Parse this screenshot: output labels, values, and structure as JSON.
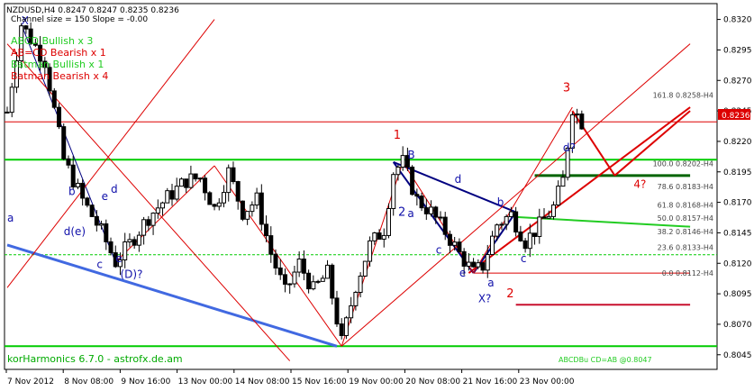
{
  "chart_window": {
    "title_line": "NZDUSD,H4  0.8247 0.8247 0.8235 0.8236",
    "info_line": "Channel size = 150  Slope = -0.00",
    "pattern_summary": [
      {
        "text": "ABCD Bullish x 3",
        "color": "#22cc22"
      },
      {
        "text": "AB=CD Bearish x 1",
        "color": "#dd0000"
      },
      {
        "text": "Batman Bullish x 1",
        "color": "#22cc22"
      },
      {
        "text": "Batman Bearish x 4",
        "color": "#dd0000"
      }
    ],
    "footer_left": "korHarmonics 6.7.0 - astrofx.de.am",
    "footer_right": "ABCDBu CD=AB   @0.8047",
    "current_price": "0.8236",
    "colors": {
      "bull": "#00cc00",
      "bear": "#dd0000",
      "pattern_blue": "#000080",
      "label_blue": "#1010aa",
      "price_box": "#dd0000",
      "trend_blue": "#4169e1",
      "darkgreen": "#006400",
      "crimson": "#c8102e"
    }
  },
  "chart_data": {
    "type": "candlestick",
    "symbol": "NZDUSD",
    "timeframe": "H4",
    "y_range": [
      0.8033,
      0.8333
    ],
    "x_ticks": [
      "7 Nov 2012",
      "8 Nov 08:00",
      "9 Nov 16:00",
      "13 Nov 00:00",
      "14 Nov 08:00",
      "15 Nov 16:00",
      "19 Nov 00:00",
      "20 Nov 08:00",
      "21 Nov 16:00",
      "23 Nov 00:00"
    ],
    "y_ticks": [
      "0.8320",
      "0.8295",
      "0.8270",
      "0.8245",
      "0.8220",
      "0.8195",
      "0.8170",
      "0.8145",
      "0.8120",
      "0.8095",
      "0.8070",
      "0.8045"
    ],
    "fib_levels": [
      {
        "label": "161.8  0.8258-H4",
        "price": 0.8258
      },
      {
        "label": "100.0  0.8202-H4",
        "price": 0.8202
      },
      {
        "label": "78.6  0.8183-H4",
        "price": 0.8183
      },
      {
        "label": "61.8  0.8168-H4",
        "price": 0.8168
      },
      {
        "label": "50.0  0.8157-H4",
        "price": 0.8157
      },
      {
        "label": "38.2  0.8146-H4",
        "price": 0.8146
      },
      {
        "label": "23.6  0.8133-H4",
        "price": 0.8133
      },
      {
        "label": "0.0  0.8112-H4",
        "price": 0.8112
      }
    ],
    "pattern_labels": [
      {
        "text": "X",
        "color": "#1010aa",
        "price": 0.8316,
        "bar": 3
      },
      {
        "text": "a",
        "color": "#1010aa",
        "price": 0.8154,
        "bar": 0
      },
      {
        "text": "b",
        "color": "#1010aa",
        "price": 0.8176,
        "bar": 13
      },
      {
        "text": "c",
        "color": "#1010aa",
        "price": 0.8116,
        "bar": 19
      },
      {
        "text": "d",
        "color": "#1010aa",
        "price": 0.8178,
        "bar": 22
      },
      {
        "text": "e",
        "color": "#1010aa",
        "price": 0.8172,
        "bar": 20
      },
      {
        "text": "d(e)",
        "color": "#1010aa",
        "price": 0.8143,
        "bar": 12
      },
      {
        "text": "e",
        "color": "#1010aa",
        "price": 0.8121,
        "bar": 23
      },
      {
        "text": "(D)?",
        "color": "#1010aa",
        "price": 0.8108,
        "bar": 24
      },
      {
        "text": "1",
        "color": "#dd0000",
        "price": 0.8222,
        "bar": 82
      },
      {
        "text": "B",
        "color": "#1010aa",
        "price": 0.8206,
        "bar": 85
      },
      {
        "text": "2",
        "color": "#1010aa",
        "price": 0.8159,
        "bar": 83
      },
      {
        "text": "a",
        "color": "#1010aa",
        "price": 0.8158,
        "bar": 85
      },
      {
        "text": "d",
        "color": "#1010aa",
        "price": 0.8186,
        "bar": 95
      },
      {
        "text": "c",
        "color": "#1010aa",
        "price": 0.8128,
        "bar": 91
      },
      {
        "text": "b",
        "color": "#1010aa",
        "price": 0.8167,
        "bar": 104
      },
      {
        "text": "e",
        "color": "#1010aa",
        "price": 0.8109,
        "bar": 96
      },
      {
        "text": "a",
        "color": "#1010aa",
        "price": 0.8101,
        "bar": 102
      },
      {
        "text": "X?",
        "color": "#1010aa",
        "price": 0.8088,
        "bar": 100
      },
      {
        "text": "2",
        "color": "#dd0000",
        "price": 0.8092,
        "bar": 106
      },
      {
        "text": "c",
        "color": "#1010aa",
        "price": 0.8121,
        "bar": 109
      },
      {
        "text": "d?",
        "color": "#1010aa",
        "price": 0.8212,
        "bar": 118
      },
      {
        "text": "3",
        "color": "#dd0000",
        "price": 0.8261,
        "bar": 118
      },
      {
        "text": "4?",
        "color": "#dd0000",
        "price": 0.8182,
        "bar": 133
      }
    ]
  }
}
